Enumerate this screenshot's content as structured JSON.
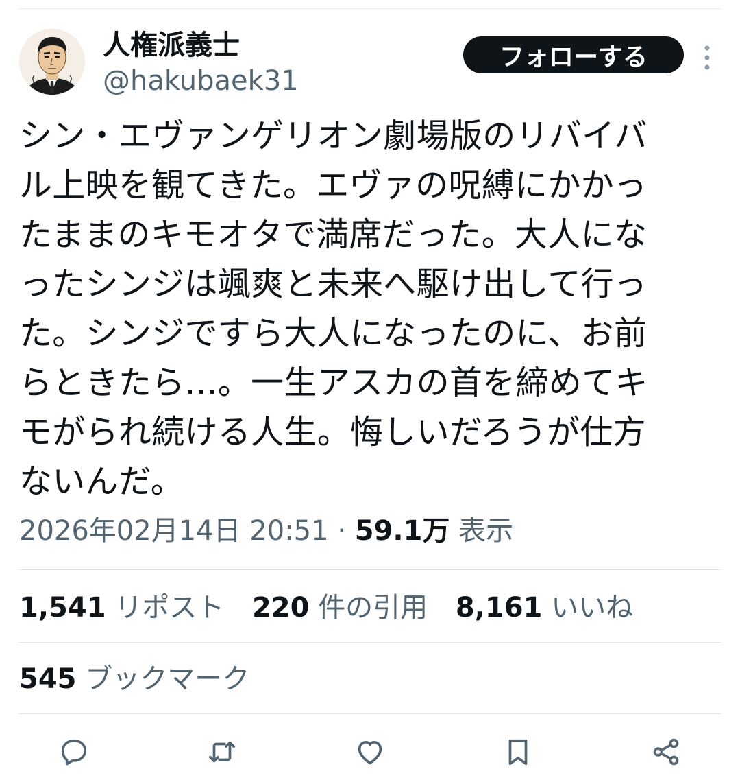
{
  "user": {
    "display_name": "人権派義士",
    "handle": "@hakubaek31",
    "avatar_icon": "avatar-illustration"
  },
  "header": {
    "follow_label": "フォローする",
    "more_icon": "more-vertical-icon"
  },
  "tweet": {
    "lines": [
      "シン・エヴァンゲリオン劇場版のリバイバ",
      "ル上映を観てきた。エヴァの呪縛にかかっ",
      "たままのキモオタで満席だった。大人にな",
      "ったシンジは颯爽と未来へ駆け出して行っ",
      "た。シンジですら大人になったのに、お前",
      "らときたら…。一生アスカの首を締めてキ",
      "モがられ続ける人生。悔しいだろうが仕方",
      "ないんだ。"
    ]
  },
  "meta": {
    "timestamp": "2026年02月14日 20:51",
    "separator": "·",
    "views_count": "59.1万",
    "views_label": "表示"
  },
  "stats": {
    "reposts_count": "1,541",
    "reposts_label": "リポスト",
    "quotes_count": "220",
    "quotes_label": "件の引用",
    "likes_count": "8,161",
    "likes_label": "いいね",
    "bookmarks_count": "545",
    "bookmarks_label": "ブックマーク"
  },
  "actions": {
    "icons": [
      "reply-icon",
      "repost-icon",
      "like-icon",
      "bookmark-icon",
      "share-icon"
    ]
  },
  "colors": {
    "text": "#0f1419",
    "secondary": "#536471",
    "divider": "#e1e6ea",
    "button_bg": "#0f1419",
    "button_text": "#ffffff"
  }
}
